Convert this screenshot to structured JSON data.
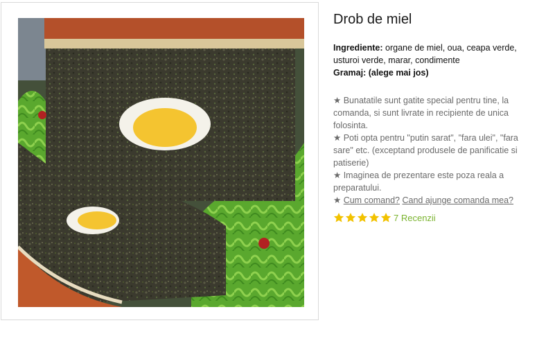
{
  "product": {
    "title": "Drob de miel",
    "ingredients_label": "Ingrediente:",
    "ingredients": "organe de miel, oua, ceapa verde, usturoi verde, marar, condimente",
    "weight_label": "Gramaj: (alege mai jos)"
  },
  "notes": {
    "bullet": "★",
    "line1": "Bunatatile sunt gatite special pentru tine, la comanda, si sunt livrate in recipiente de unica folosinta.",
    "line2": "Poti opta pentru \"putin sarat\", \"fara ulei\", \"fara sare\" etc. (exceptand produsele de panificatie si patiserie)",
    "line3": "Imaginea de prezentare este poza reala a preparatului.",
    "link1": "Cum comand?",
    "link2": "Cand ajunge comanda mea?"
  },
  "rating": {
    "stars": 5,
    "max_stars": 5,
    "reviews": "7 Recenzii"
  },
  "colors": {
    "star": "#f2c200",
    "reviews": "#7ab32e"
  }
}
